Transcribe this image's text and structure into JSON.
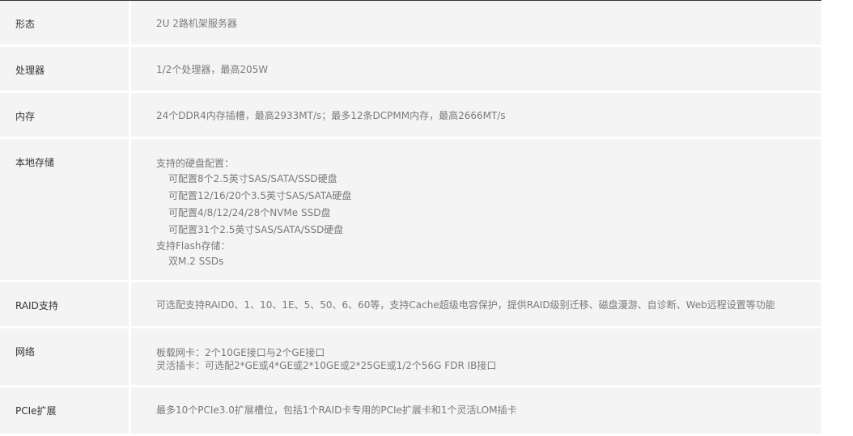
{
  "rows": [
    {
      "label": "形态",
      "lines": [
        "2U 2路机架服务器"
      ]
    },
    {
      "label": "处理器",
      "lines": [
        "1/2个处理器，最高205W"
      ]
    },
    {
      "label": "内存",
      "lines": [
        "24个DDR4内存插槽，最高2933MT/s；最多12条DCPMM内存，最高2666MT/s"
      ]
    },
    {
      "label": "本地存储",
      "lines": [
        "支持的硬盘配置：",
        "可配置8个2.5英寸SAS/SATA/SSD硬盘",
        "可配置12/16/20个3.5英寸SAS/SATA硬盘",
        "可配置4/8/12/24/28个NVMe SSD盘",
        "可配置31个2.5英寸SAS/SATA/SSD硬盘",
        "支持Flash存储：",
        "双M.2 SSDs"
      ]
    },
    {
      "label": "RAID支持",
      "lines": [
        "可选配支持RAID0、1、10、1E、5、50、6、60等，支持Cache超级电容保护，提供RAID级别迁移、磁盘漫游、自诊断、Web远程设置等功能"
      ]
    },
    {
      "label": "网络",
      "lines": [
        "板载网卡：2个10GE接口与2个GE接口",
        "灵活插卡：可选配2*GE或4*GE或2*10GE或2*25GE或1/2个56G FDR IB接口"
      ]
    },
    {
      "label": "PCIe扩展",
      "lines": [
        "最多10个PCIe3.0扩展槽位，包括1个RAID卡专用的PCIe扩展卡和1个灵活LOM插卡"
      ]
    }
  ]
}
